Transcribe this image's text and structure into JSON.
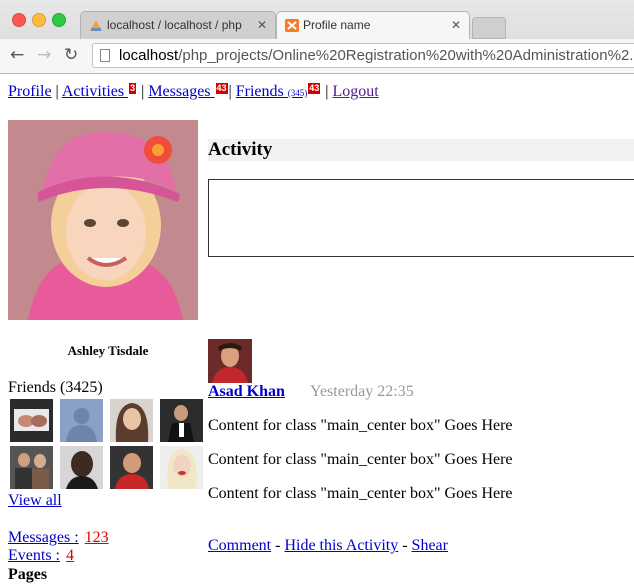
{
  "browser": {
    "tabs": [
      {
        "title": "localhost / localhost / php"
      },
      {
        "title": "Profile name"
      }
    ],
    "url_host": "localhost",
    "url_path": "/php_projects/Online%20Registration%20with%20Administration%2..."
  },
  "nav": {
    "profile": "Profile",
    "sep": "|",
    "activities": "Activities",
    "activities_badge": "3",
    "messages": "Messages",
    "messages_badge": "43",
    "friends": "Friends",
    "friends_count_small": "(345)",
    "friends_badge": "43",
    "logout": "Logout"
  },
  "profile": {
    "name": "Ashley Tisdale",
    "friends_title": "Friends (3425)",
    "view_all": "View all",
    "messages_label": "Messages :",
    "messages_count": "123",
    "events_label": "Events :",
    "events_count": "4",
    "pages_label": "Pages"
  },
  "activity": {
    "heading": "Activity",
    "post": {
      "author": "Asad Khan",
      "time": "Yesterday 22:35",
      "lines": [
        "Content for class \"main_center box\" Goes Here",
        "Content for class \"main_center box\" Goes Here",
        "Content for class \"main_center box\" Goes Here"
      ],
      "comment": "Comment",
      "dash": "-",
      "hide": "Hide this Activity",
      "shear": "Shear"
    }
  },
  "colors": {
    "link": "#0000cc",
    "visited": "#551a8b",
    "badge": "#d40000",
    "time_gray": "#999999"
  }
}
